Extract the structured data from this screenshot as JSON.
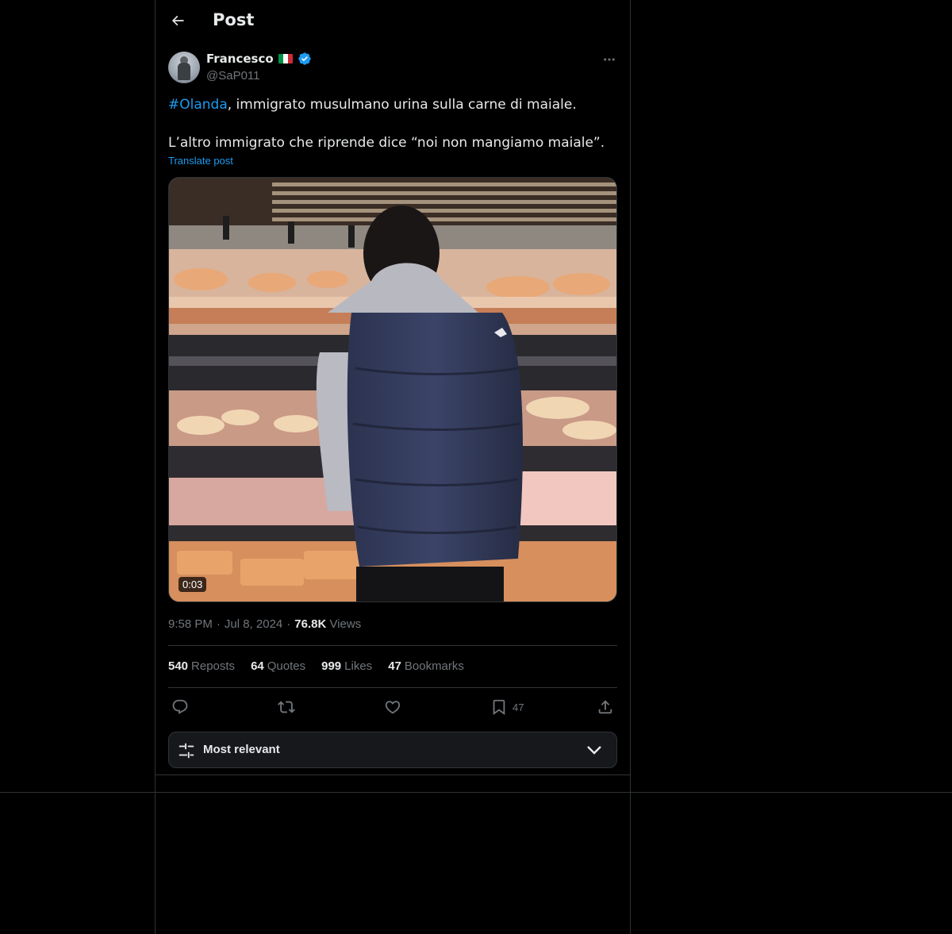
{
  "header": {
    "title": "Post"
  },
  "author": {
    "name": "Francesco",
    "handle": "@SaP011",
    "flag": "italy-flag",
    "verified": true
  },
  "post": {
    "hashtag": "#Olanda",
    "line1_rest": ", immigrato musulmano urina sulla carne di maiale.",
    "line2": "L’altro immigrato che riprende dice “noi non mangiamo maiale”.",
    "translate_label": "Translate post"
  },
  "media": {
    "duration": "0:03"
  },
  "meta": {
    "time": "9:58 PM",
    "date": "Jul 8, 2024",
    "separator": "·",
    "views_count": "76.8K",
    "views_label": "Views"
  },
  "stats": {
    "reposts_count": "540",
    "reposts_label": "Reposts",
    "quotes_count": "64",
    "quotes_label": "Quotes",
    "likes_count": "999",
    "likes_label": "Likes",
    "bookmarks_count": "47",
    "bookmarks_label": "Bookmarks"
  },
  "actions": {
    "bookmark_count": "47"
  },
  "sort": {
    "label": "Most relevant"
  },
  "colors": {
    "background": "#000000",
    "text": "#e7e9ea",
    "muted": "#71767b",
    "accent": "#1d9bf0",
    "border": "#2f3336"
  }
}
